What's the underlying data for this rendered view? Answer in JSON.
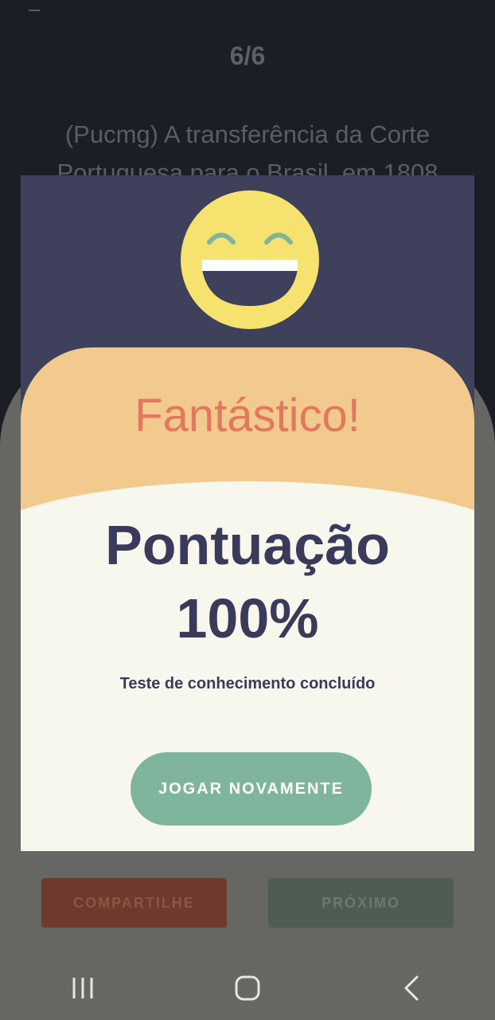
{
  "background": {
    "counter": "6/6",
    "question": "(Pucmg) A transferência da Corte Portuguesa para o Brasil, em 1808",
    "share_label": "COMPARTILHE",
    "next_label": "PRÓXIMO"
  },
  "dialog": {
    "emoji": "grinning-face-icon",
    "headline": "Fantástico!",
    "score_label": "Pontuação",
    "score_value": "100%",
    "status_text": "Teste de conhecimento concluído",
    "play_again_label": "JOGAR NOVAMENTE"
  },
  "navbar": {
    "icons": [
      "recent-apps-icon",
      "home-icon",
      "back-icon"
    ]
  },
  "colors": {
    "dialog_top": "#3f405c",
    "dialog_orange": "#f2ca8d",
    "dialog_cream": "#f8f7ee",
    "headline": "#e2785e",
    "score_text": "#3a3b5a",
    "play_again_button": "#7fb59c",
    "share_button": "#6e3a2e",
    "next_button": "#4f5c51"
  }
}
